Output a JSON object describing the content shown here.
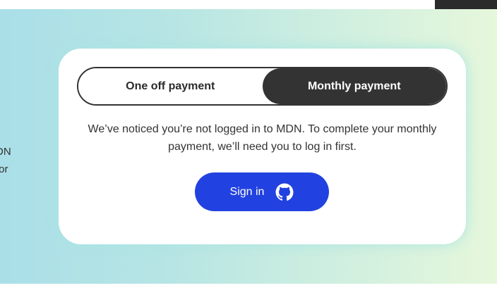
{
  "side_text": {
    "line1": "DN",
    "line2": "for"
  },
  "payment_toggle": {
    "one_off_label": "One off payment",
    "monthly_label": "Monthly payment",
    "selected": "monthly"
  },
  "message": "We’ve noticed you’re not logged in to MDN. To complete your monthly payment, we’ll need you to log in first.",
  "signin": {
    "label": "Sign in",
    "icon": "github-icon"
  },
  "colors": {
    "signin_bg": "#2142e0",
    "toggle_selected_bg": "#333333",
    "gradient_start": "#aadfe8",
    "gradient_end": "#e6f7db"
  }
}
